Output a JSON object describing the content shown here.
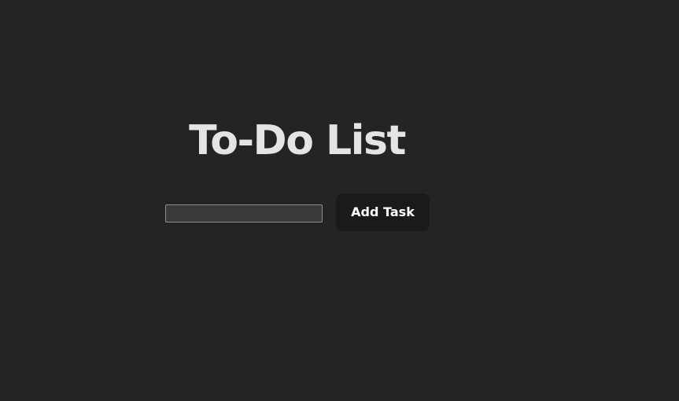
{
  "page": {
    "title": "To-Do List"
  },
  "task_input": {
    "value": "",
    "placeholder": ""
  },
  "add_button": {
    "label": "Add Task"
  },
  "colors": {
    "background": "#242424",
    "title_text": "#e4e4e4",
    "input_background": "#3a3a3a",
    "input_border": "#8c8c8c",
    "button_background": "#1a1a1a",
    "button_text": "#ffffff"
  }
}
